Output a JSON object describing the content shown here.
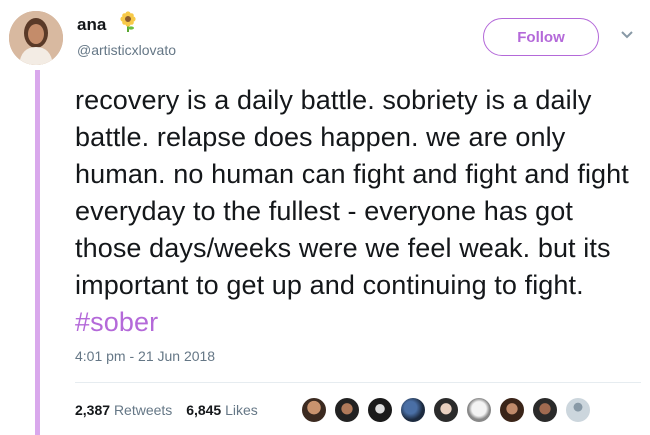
{
  "user": {
    "name": "ana",
    "handle": "@artisticxlovato",
    "emoji_icon": "sunflower-icon"
  },
  "follow_button": {
    "label": "Follow"
  },
  "tweet": {
    "text": "recovery is a daily battle. sobriety is a daily battle. relapse does happen. we are only human. no human can fight and fight and fight everyday to the fullest - everyone has got those days/weeks were we feel weak. but its important to get up and continuing to fight.",
    "hashtag": "#sober",
    "timestamp": "4:01 pm - 21 Jun 2018"
  },
  "stats": {
    "retweets_count": "2,387",
    "retweets_label": "Retweets",
    "likes_count": "6,845",
    "likes_label": "Likes"
  },
  "colors": {
    "accent": "#b469d9",
    "thread_line": "#d9a8ec",
    "muted_text": "#657786"
  },
  "liker_avatars": [
    "avatar-1",
    "avatar-2",
    "avatar-3",
    "avatar-4",
    "avatar-5",
    "avatar-6",
    "avatar-7",
    "avatar-8",
    "avatar-9"
  ]
}
